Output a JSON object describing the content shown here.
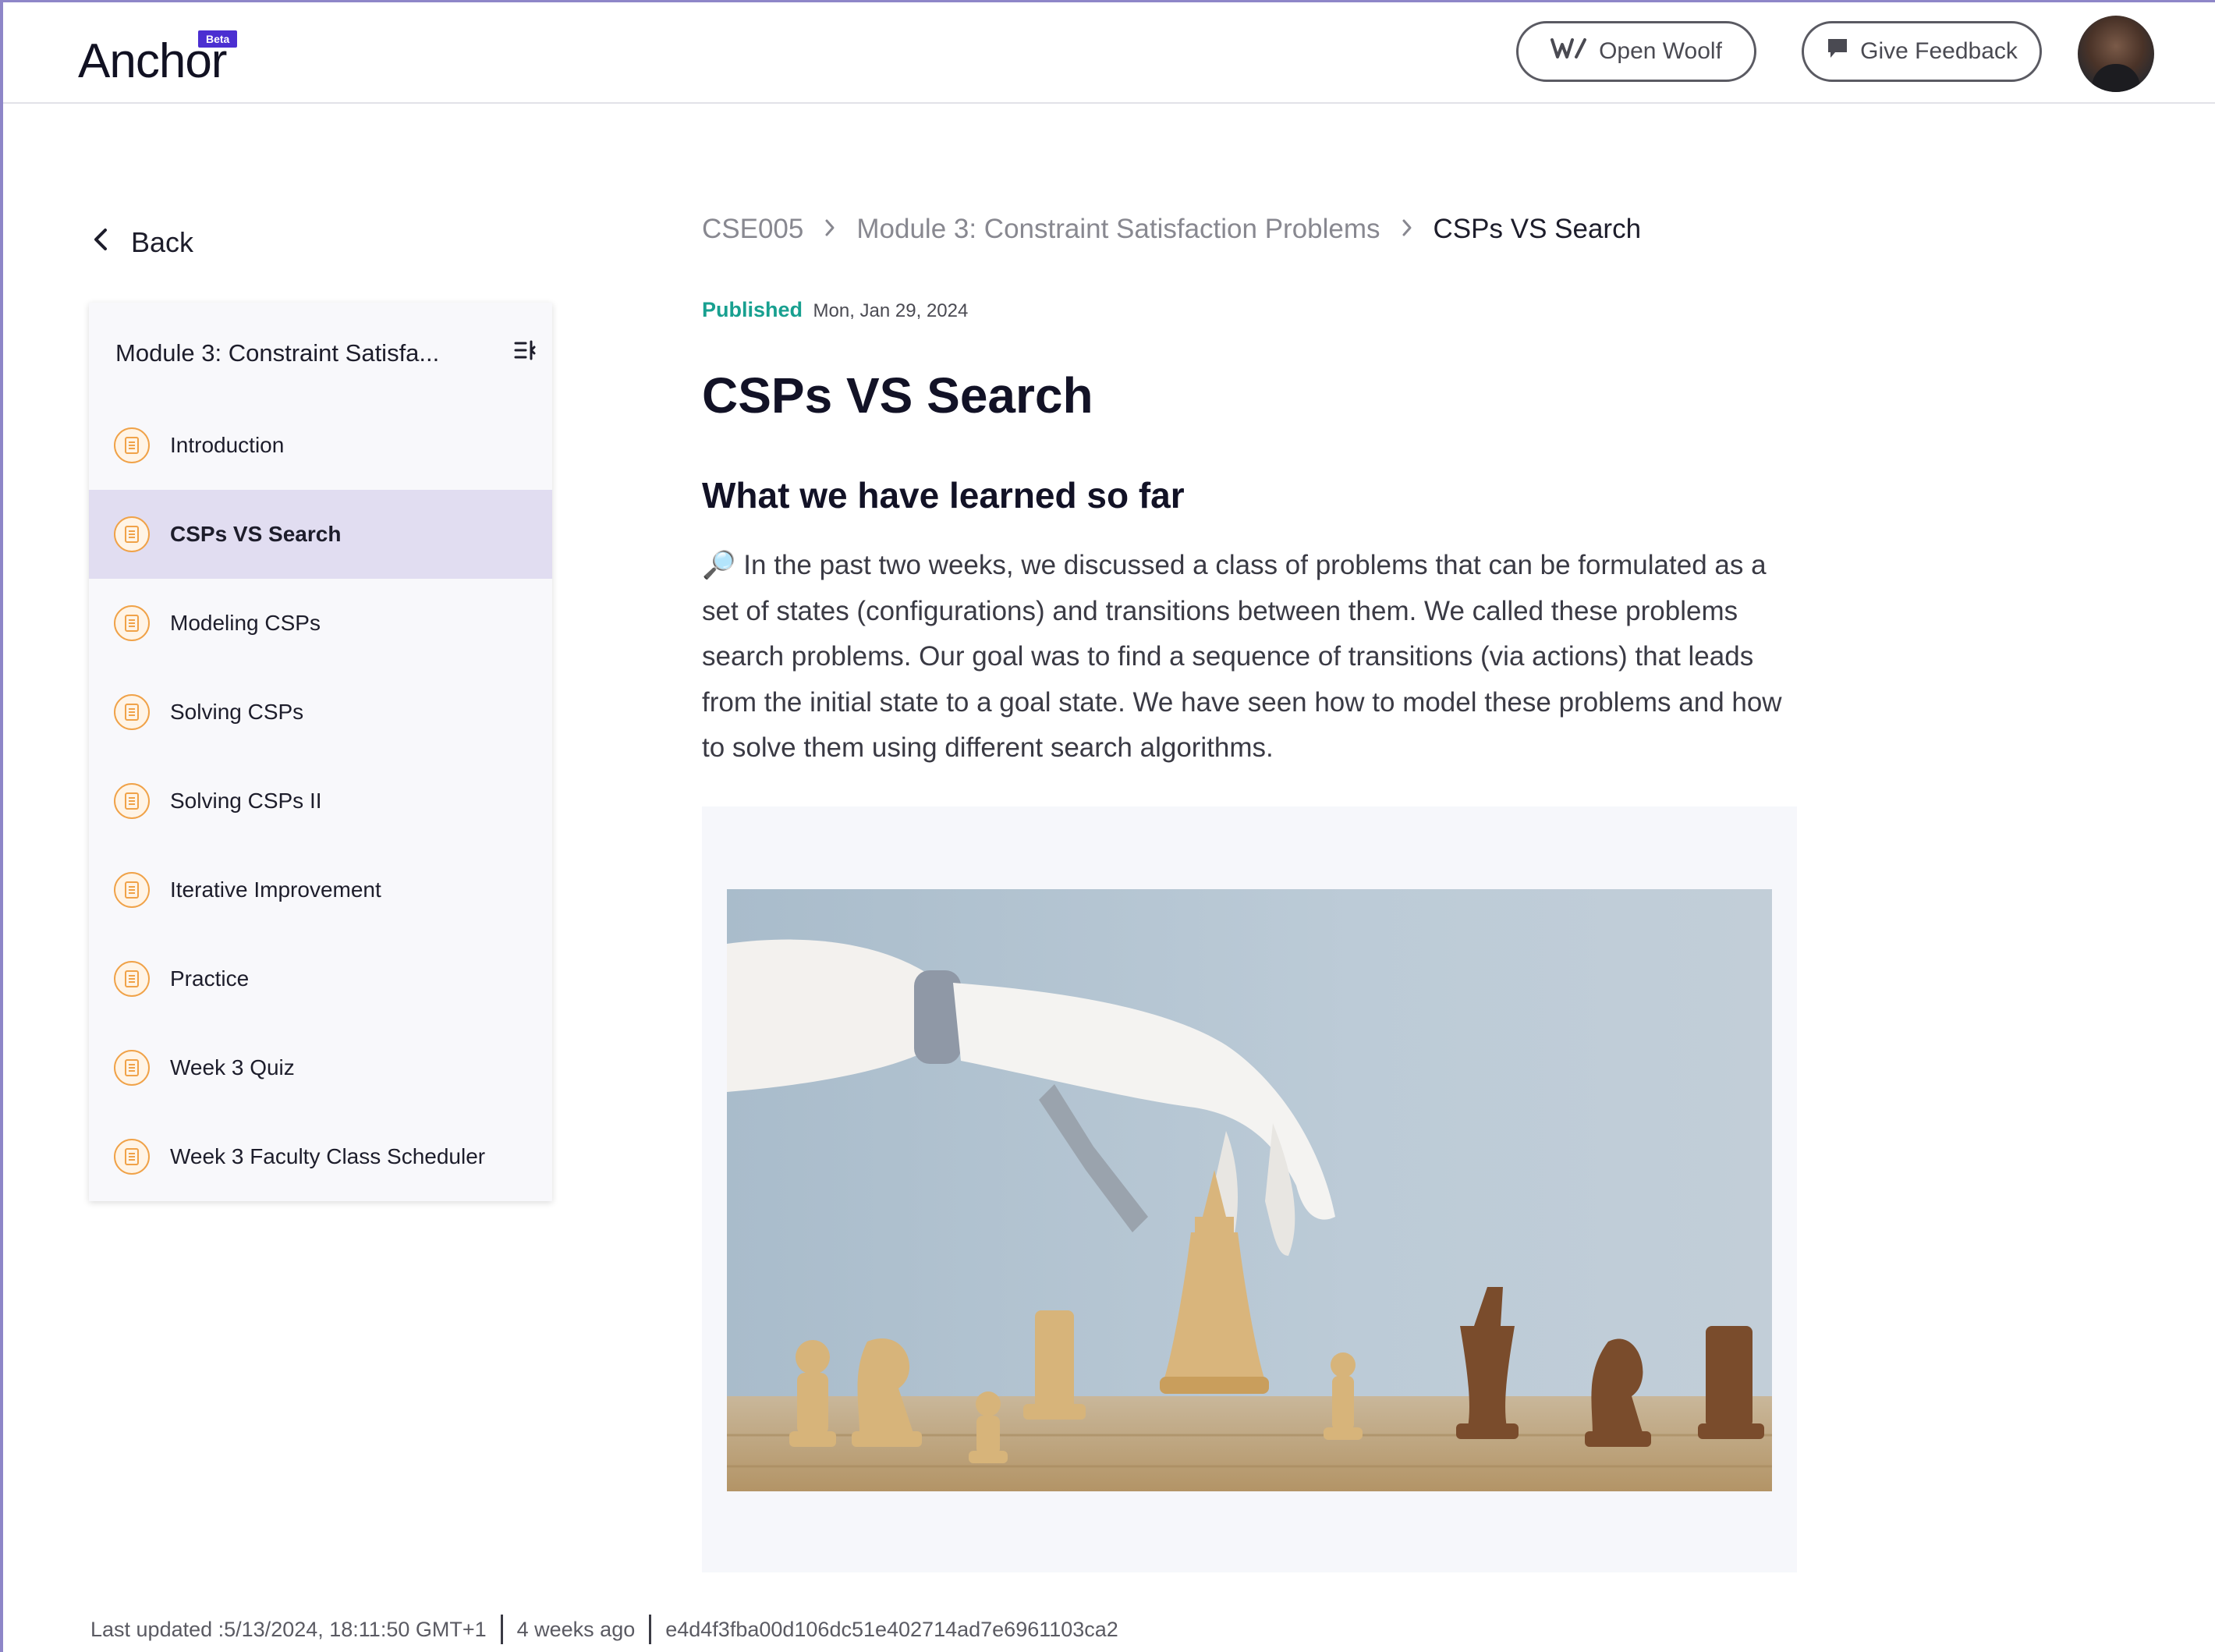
{
  "app": {
    "logo_text": "Anchor",
    "beta_badge": "Beta"
  },
  "header": {
    "open_woolf_label": "Open Woolf",
    "give_feedback_label": "Give Feedback"
  },
  "sidebar": {
    "back_label": "Back",
    "module_title": "Module 3: Constraint Satisfa...",
    "items": [
      {
        "label": "Introduction",
        "active": false
      },
      {
        "label": "CSPs VS Search",
        "active": true
      },
      {
        "label": "Modeling CSPs",
        "active": false
      },
      {
        "label": "Solving CSPs",
        "active": false
      },
      {
        "label": "Solving CSPs II",
        "active": false
      },
      {
        "label": "Iterative Improvement",
        "active": false
      },
      {
        "label": "Practice",
        "active": false
      },
      {
        "label": "Week 3 Quiz",
        "active": false
      },
      {
        "label": "Week 3 Faculty Class Scheduler",
        "active": false
      }
    ]
  },
  "breadcrumb": {
    "course": "CSE005",
    "module": "Module 3: Constraint Satisfaction Problems",
    "current": "CSPs VS Search"
  },
  "article": {
    "published_label": "Published",
    "published_date": "Mon, Jan 29, 2024",
    "title": "CSPs VS Search",
    "subtitle": "What we have learned so far",
    "paragraph": "🔎 In the past two weeks, we discussed a class of problems that can be formulated as a set of states (configurations) and transitions between them. We called these problems search problems. Our goal was to find a sequence of transitions (via actions) that leads from the initial state to a goal state. We have seen how to model these problems and how to solve them using different search algorithms."
  },
  "footer": {
    "last_updated": "Last updated :5/13/2024, 18:11:50 GMT+1",
    "relative_time": "4 weeks ago",
    "commit_hash": "e4d4f3fba00d106dc51e402714ad7e6961103ca2"
  },
  "colors": {
    "accent_purple": "#4b2fd1",
    "published_green": "#18a090",
    "active_item_bg": "#e1ddf1",
    "doc_icon_orange": "#f0a248"
  }
}
